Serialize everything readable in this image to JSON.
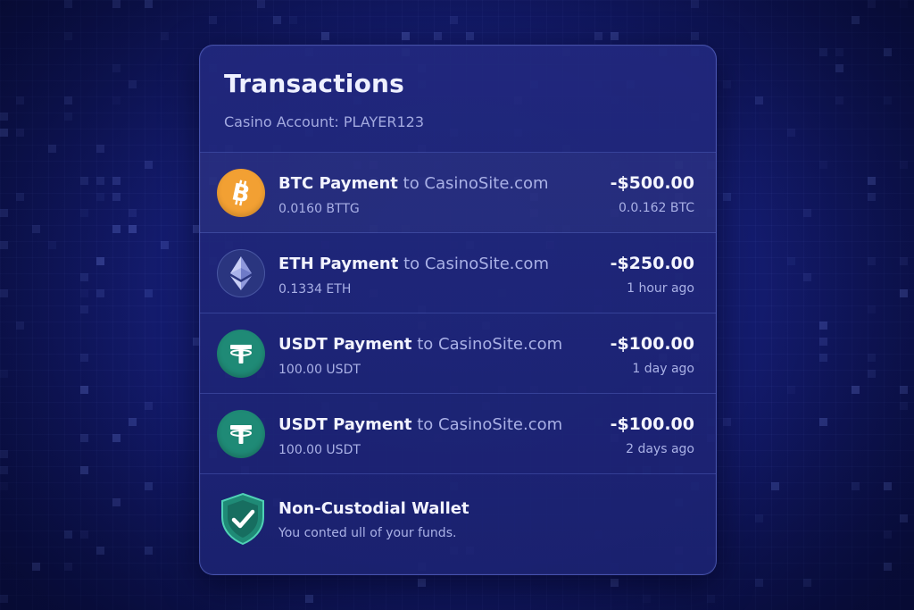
{
  "header": {
    "title": "Transactions",
    "account": "Casino Account: PLAYER123"
  },
  "transactions": [
    {
      "icon": "bitcoin-icon",
      "coin": "BTC Payment",
      "destination": "to CasinoSite.com",
      "crypto_amount": "0.0160 BTTG",
      "amount": "-$500.00",
      "meta": "0.0.162 BTC",
      "color": "#f2a033"
    },
    {
      "icon": "ethereum-icon",
      "coin": "ETH Payment",
      "destination": "to CasinoSite.com",
      "crypto_amount": "0.1334 ETH",
      "amount": "-$250.00",
      "meta": "1 hour ago",
      "color": "#2a357f"
    },
    {
      "icon": "tether-icon",
      "coin": "USDT Payment",
      "destination": "to CasinoSite.com",
      "crypto_amount": "100.00 USDT",
      "amount": "-$100.00",
      "meta": "1 day ago",
      "color": "#1f8a76"
    },
    {
      "icon": "tether-icon",
      "coin": "USDT Payment",
      "destination": "to CasinoSite.com",
      "crypto_amount": "100.00 USDT",
      "amount": "-$100.00",
      "meta": "2 days ago",
      "color": "#1f8a76"
    }
  ],
  "wallet": {
    "icon": "shield-check-icon",
    "title": "Non-Custodial Wallet",
    "subtitle": "You conted ull of your funds."
  },
  "colors": {
    "background": "#111864",
    "card": "#1f2677",
    "text_primary": "#f2f3ff",
    "text_secondary": "#aab1e6"
  }
}
